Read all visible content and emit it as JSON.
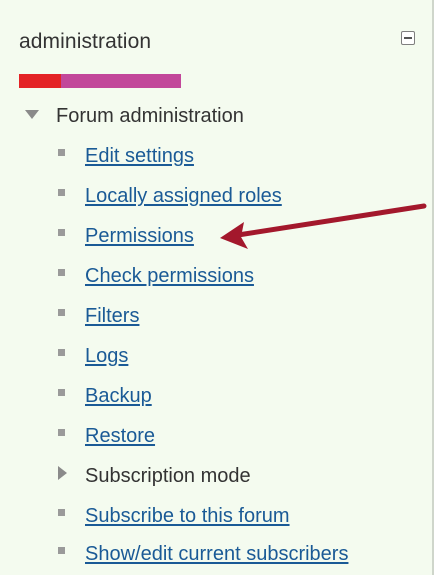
{
  "block": {
    "title": "administration",
    "collapse_icon": "minus-box-icon",
    "colorbar": {
      "red": "#e42326",
      "pink": "#c2479a"
    }
  },
  "tree": {
    "root_label": "Forum administration",
    "items": [
      {
        "label": "Edit settings",
        "type": "link"
      },
      {
        "label": "Locally assigned roles",
        "type": "link"
      },
      {
        "label": "Permissions",
        "type": "link"
      },
      {
        "label": "Check permissions",
        "type": "link"
      },
      {
        "label": "Filters",
        "type": "link"
      },
      {
        "label": "Logs",
        "type": "link"
      },
      {
        "label": "Backup",
        "type": "link"
      },
      {
        "label": "Restore",
        "type": "link"
      },
      {
        "label": "Subscription mode",
        "type": "expandable"
      },
      {
        "label": "Subscribe to this forum",
        "type": "link"
      },
      {
        "label": "Show/edit current subscribers",
        "type": "link"
      }
    ]
  },
  "annotation": {
    "arrow_color": "#a3182c",
    "points_to": "Permissions"
  }
}
